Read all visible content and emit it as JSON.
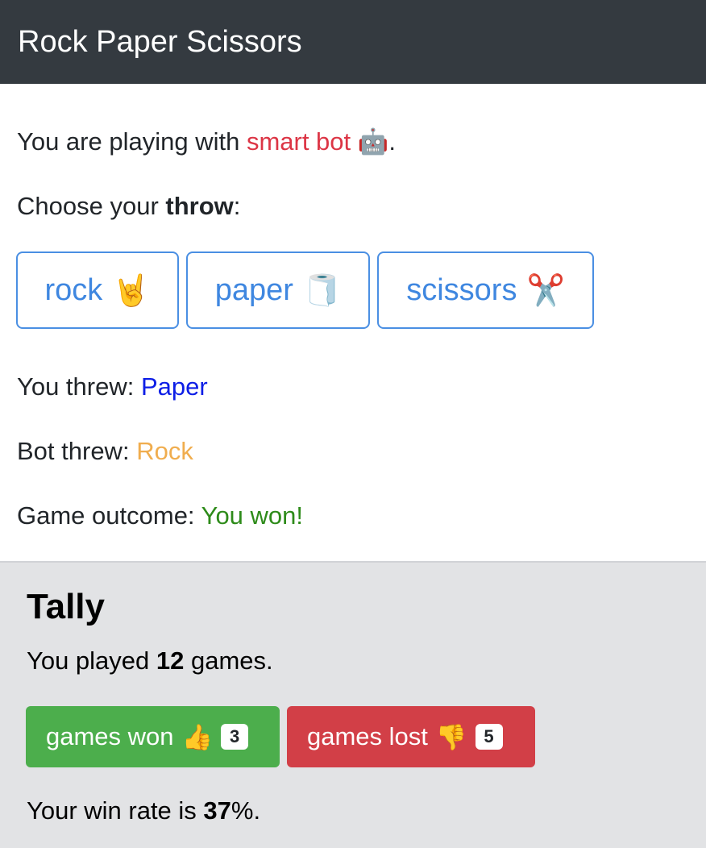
{
  "navbar": {
    "title": "Rock Paper Scissors"
  },
  "intro": {
    "prefix": "You are playing with ",
    "bot_name": "smart bot",
    "bot_emoji": "🤖",
    "suffix": "."
  },
  "choose": {
    "prefix": "Choose your ",
    "bold": "throw",
    "suffix": ":"
  },
  "throws": [
    {
      "label": "rock",
      "emoji": "🤘"
    },
    {
      "label": "paper",
      "emoji": "🧻"
    },
    {
      "label": "scissors",
      "emoji": "✂️"
    }
  ],
  "result": {
    "you_label": "You threw: ",
    "you_value": "Paper",
    "bot_label": "Bot threw: ",
    "bot_value": "Rock",
    "outcome_label": "Game outcome: ",
    "outcome_value": "You won!"
  },
  "tally": {
    "title": "Tally",
    "played_prefix": "You played ",
    "played_count": "12",
    "played_suffix": " games.",
    "won_label": "games won",
    "won_emoji": "👍",
    "won_count": "3",
    "lost_label": "games lost",
    "lost_emoji": "👎",
    "lost_count": "5",
    "winrate_prefix": "Your win rate is ",
    "winrate_value": "37",
    "winrate_suffix": "%."
  },
  "colors": {
    "navbar": "#343a40",
    "bot_name": "#dc3545",
    "player_throw": "#0d1ee6",
    "bot_throw": "#f0ad4e",
    "outcome": "#2e8b1a",
    "won": "#4cae4c",
    "lost": "#d23f47"
  }
}
